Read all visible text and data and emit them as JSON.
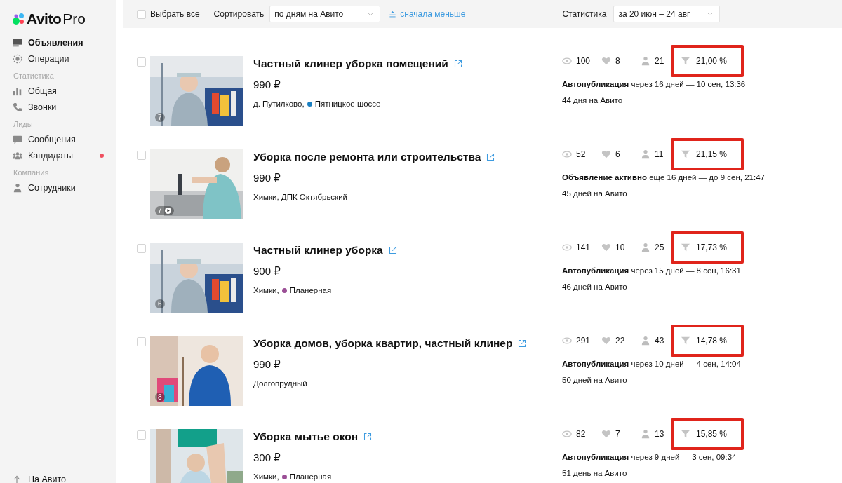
{
  "sidebar": {
    "logo": {
      "brand": "Avito",
      "suffix": "Pro"
    },
    "sections": [
      {
        "items": [
          {
            "label": "Объявления",
            "selected": true,
            "badge": false
          },
          {
            "label": "Операции",
            "selected": false,
            "badge": false
          }
        ]
      },
      {
        "heading": "Статистика",
        "items": [
          {
            "label": "Общая",
            "selected": false,
            "badge": false
          },
          {
            "label": "Звонки",
            "selected": false,
            "badge": false
          }
        ]
      },
      {
        "heading": "Лиды",
        "items": [
          {
            "label": "Сообщения",
            "selected": false,
            "badge": false
          },
          {
            "label": "Кандидаты",
            "selected": false,
            "badge": true
          }
        ]
      },
      {
        "heading": "Компания",
        "items": [
          {
            "label": "Сотрудники",
            "selected": false,
            "badge": false
          }
        ]
      }
    ],
    "footer_link": "На Авито"
  },
  "toolbar": {
    "select_all": {
      "label": "Выбрать все",
      "checked": false
    },
    "sort_label": "Сортировать",
    "sort_value": "по дням на Авито",
    "order_link": "сначала меньше",
    "stats_label": "Статистика",
    "period_value": "за 20 июн – 24 авг"
  },
  "listings": [
    {
      "title": "Частный клинер уборка помещений",
      "price": "990 ₽",
      "place": "д. Путилково,",
      "metro": {
        "name": "Пятницкое шоссе",
        "color": "#1a7fc1"
      },
      "photo_count": "7",
      "video": false,
      "checked": false,
      "views": "100",
      "favorites": "8",
      "contacts": "21",
      "conversion": "21,00 %",
      "highlighted": true,
      "status": "**Автопубликация** через 16 дней — 10 сен, 13:36",
      "days": "44 дня на Авито"
    },
    {
      "title": "Уборка после ремонта или строительства",
      "price": "990 ₽",
      "place": "Химки, ДПК Октябрьский",
      "photo_count": "7",
      "video": true,
      "checked": false,
      "views": "52",
      "favorites": "6",
      "contacts": "11",
      "conversion": "21,15 %",
      "highlighted": true,
      "status": "**Объявление активно** ещё 16 дней — до 9 сен, 21:47",
      "days": "45 дней на Авито"
    },
    {
      "title": "Частный клинер уборка",
      "price": "900 ₽",
      "place": "Химки,",
      "metro": {
        "name": "Планерная",
        "color": "#9b4f96"
      },
      "photo_count": "6",
      "video": false,
      "checked": false,
      "views": "141",
      "favorites": "10",
      "contacts": "25",
      "conversion": "17,73 %",
      "highlighted": true,
      "status": "**Автопубликация** через 15 дней — 8 сен, 16:31",
      "days": "46 дней на Авито"
    },
    {
      "title": "Уборка домов, уборка квартир, частный клинер",
      "price": "990 ₽",
      "place": "Долгопрудный",
      "photo_count": "8",
      "video": false,
      "checked": false,
      "views": "291",
      "favorites": "22",
      "contacts": "43",
      "conversion": "14,78 %",
      "highlighted": true,
      "status": "**Автопубликация** через 10 дней — 4 сен, 14:04",
      "days": "50 дней на Авито"
    },
    {
      "title": "Уборка мытье окон",
      "price": "300 ₽",
      "place": "Химки,",
      "metro": {
        "name": "Планерная",
        "color": "#9b4f96"
      },
      "checked": false,
      "views": "82",
      "favorites": "7",
      "contacts": "13",
      "conversion": "15,85 %",
      "highlighted": true,
      "status": "**Автопубликация** через 9 дней — 3 сен, 09:34",
      "days": "51 день на Авито"
    }
  ]
}
